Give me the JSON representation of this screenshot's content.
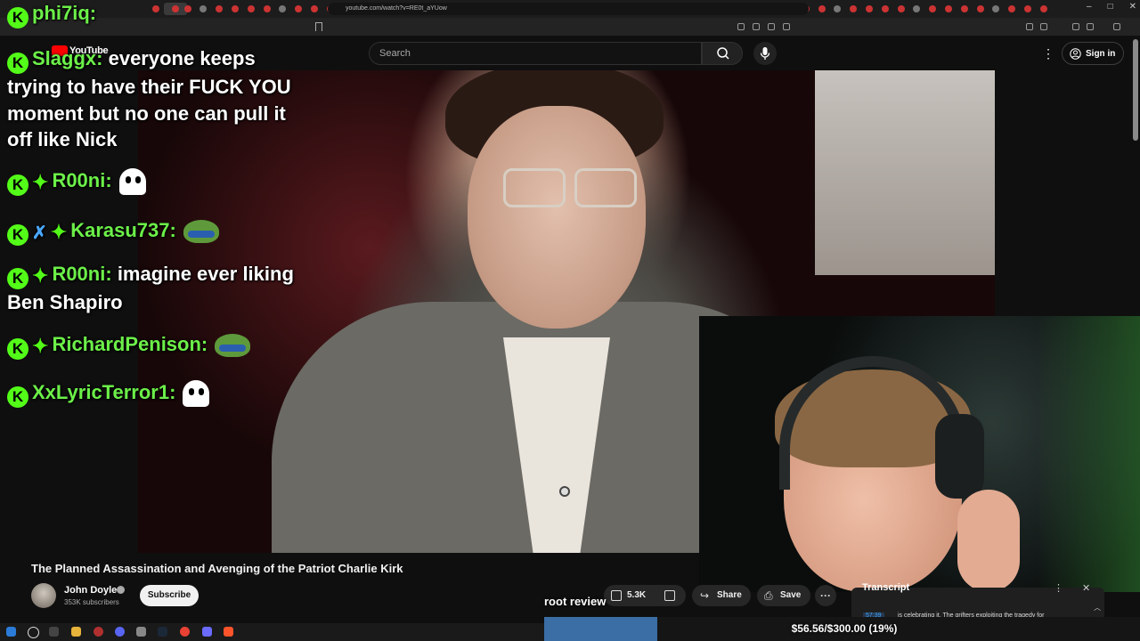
{
  "browser": {
    "url": "youtube.com/watch?v=RE0t_aYUow",
    "window_controls": [
      "–",
      "□",
      "✕"
    ]
  },
  "youtube": {
    "logo_text": "YouTube",
    "search_placeholder": "Search",
    "signin_label": "Sign in"
  },
  "chat": {
    "messages": [
      {
        "user": "phi7iq:",
        "text": ""
      },
      {
        "user": "Slaggx:",
        "text": "everyone keeps"
      },
      {
        "user": "",
        "text": "trying to have their FUCK YOU"
      },
      {
        "user": "",
        "text": "moment but no one can pull it"
      },
      {
        "user": "",
        "text": "off like Nick"
      },
      {
        "user": "R00ni:",
        "text": ""
      },
      {
        "user": "Karasu737:",
        "text": ""
      },
      {
        "user": "R00ni:",
        "text": "imagine ever liking"
      },
      {
        "user": "",
        "text": "Ben Shapiro"
      },
      {
        "user": "RichardPenison:",
        "text": ""
      },
      {
        "user": "XxLyricTerror1:",
        "text": ""
      }
    ],
    "badge_letter": "K"
  },
  "video": {
    "title": "The Planned Assassination and Avenging of the Patriot Charlie Kirk",
    "channel": "John Doyle",
    "subscribers": "353K subscribers",
    "subscribe_label": "Subscribe",
    "likes": "5.3K",
    "share_label": "Share",
    "save_label": "Save",
    "more_label": "···"
  },
  "overlay": {
    "root_review": "root review",
    "goal_text": "$56.56/$300.00 (19%)",
    "goal_fraction": 0.19
  },
  "transcript": {
    "title": "Transcript",
    "time": "57:39",
    "text": "is celebrating it. The grifters exploiting the tragedy for"
  },
  "colors": {
    "kick_green": "#53fc18",
    "username_green": "#6cf049",
    "goal_fill": "#3a6ea5",
    "youtube_red": "#ff0000"
  }
}
